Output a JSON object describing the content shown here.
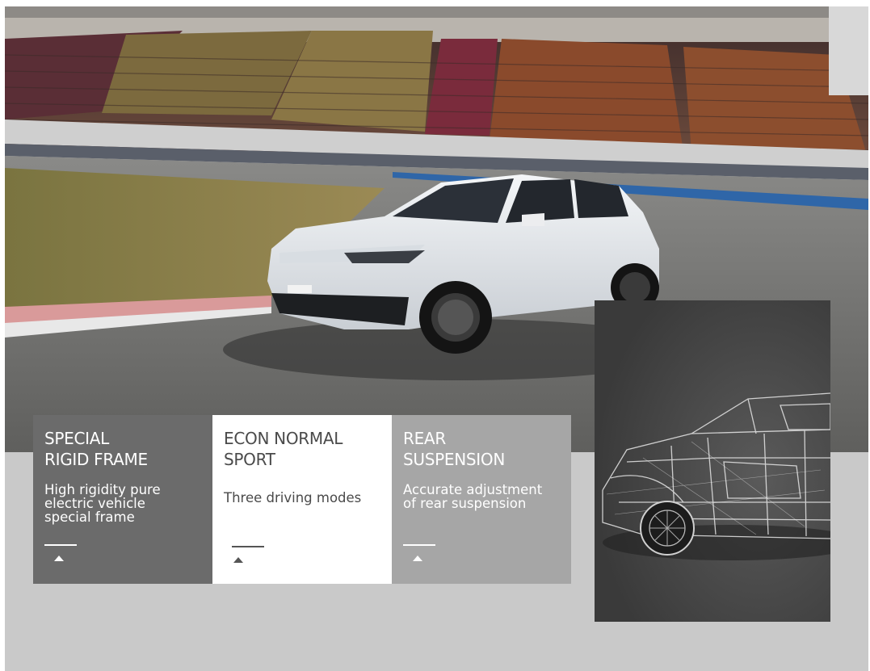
{
  "features": [
    {
      "title": "SPECIAL\nRIGID FRAME",
      "description": "High rigidity pure\nelectric vehicle\nspecial frame"
    },
    {
      "title": "ECON NORMAL\nSPORT",
      "description": "Three driving modes"
    },
    {
      "title": "REAR\nSUSPENSION",
      "description": "Accurate adjustment\nof rear suspension"
    }
  ],
  "colors": {
    "background": "#c9c9c9",
    "card_dark": "#6b6b6b",
    "card_light": "#ffffff",
    "card_mid": "#a6a6a6",
    "xray_panel": "#474747"
  },
  "icons": [
    "up-triangle-icon"
  ]
}
